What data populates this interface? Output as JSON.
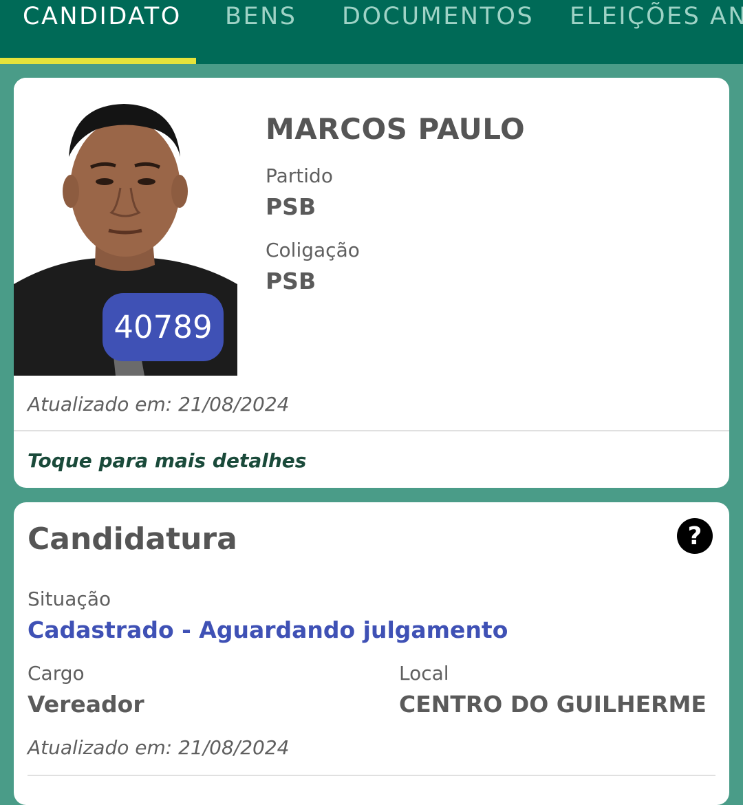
{
  "tabs": [
    {
      "label": "CANDIDATO",
      "active": true
    },
    {
      "label": "BENS",
      "active": false
    },
    {
      "label": "DOCUMENTOS",
      "active": false
    },
    {
      "label": "ELEIÇÕES AN",
      "active": false
    }
  ],
  "candidate": {
    "name": "MARCOS PAULO",
    "number": "40789",
    "party_label": "Partido",
    "party": "PSB",
    "coalition_label": "Coligação",
    "coalition": "PSB",
    "updated": "Atualizado em: 21/08/2024",
    "details_link": "Toque para mais detalhes"
  },
  "candidacy": {
    "title": "Candidatura",
    "help_icon": "?",
    "status_label": "Situação",
    "status": "Cadastrado - Aguardando julgamento",
    "office_label": "Cargo",
    "office": "Vereador",
    "location_label": "Local",
    "location": "CENTRO DO GUILHERME",
    "updated": "Atualizado em: 21/08/2024"
  },
  "colors": {
    "tabbar": "#006a57",
    "indicator": "#e6e33a",
    "background": "#4a9c88",
    "badge": "#3f51b5",
    "status": "#3f51b5"
  }
}
